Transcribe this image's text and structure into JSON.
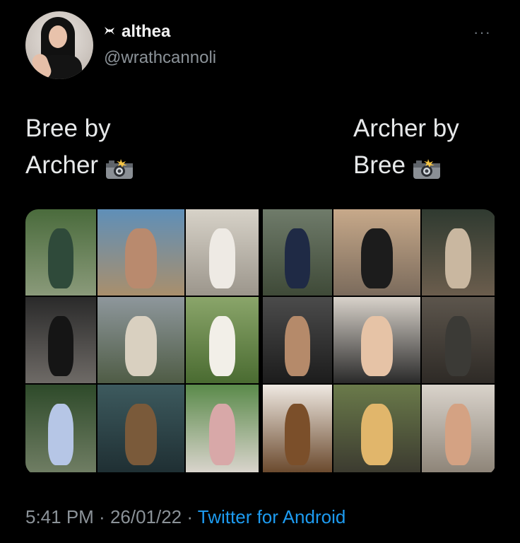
{
  "author": {
    "display_name": "althea",
    "handle": "@wrathcannoli",
    "name_icon": "bow-icon",
    "avatar_icon": "avatar-photo"
  },
  "more_label": "···",
  "tweet": {
    "left_lines": [
      "Bree by",
      "Archer"
    ],
    "right_lines": [
      "Archer by",
      "Bree"
    ],
    "emoji": "camera-with-flash-icon"
  },
  "media": {
    "left_photos": [
      {
        "name": "woman-bicycle-photo",
        "colors": [
          "#4a6b3c",
          "#8a9a7a"
        ],
        "fig": "#2f4a3a"
      },
      {
        "name": "woman-beach-crouch-photo",
        "colors": [
          "#5f8fb8",
          "#a98f6c"
        ],
        "fig": "#b98a6e"
      },
      {
        "name": "woman-kitchen-photo",
        "colors": [
          "#d7d2c8",
          "#9c968c"
        ],
        "fig": "#eeeae4"
      },
      {
        "name": "woman-mirror-photo",
        "colors": [
          "#2a2a2a",
          "#6e6a66"
        ],
        "fig": "#151515"
      },
      {
        "name": "woman-dog-hills-photo",
        "colors": [
          "#8e979c",
          "#4f5c45"
        ],
        "fig": "#d9d0c0"
      },
      {
        "name": "woman-white-dress-field-photo",
        "colors": [
          "#8aa56a",
          "#4a6b31"
        ],
        "fig": "#f2efe8"
      },
      {
        "name": "woman-garden-photo",
        "colors": [
          "#2e4a2a",
          "#6f7d63"
        ],
        "fig": "#b6c6e6"
      },
      {
        "name": "woman-pool-photo",
        "colors": [
          "#3d5a5e",
          "#1f2f33"
        ],
        "fig": "#7a5a3a"
      },
      {
        "name": "woman-pink-dress-pool-photo",
        "colors": [
          "#5a8a4a",
          "#d9d4cc"
        ],
        "fig": "#d8a8a8"
      }
    ],
    "right_photos": [
      {
        "name": "man-carrying-child-photo",
        "colors": [
          "#6f7b6a",
          "#3f4a38"
        ],
        "fig": "#1f2a45"
      },
      {
        "name": "man-beach-dog-photo",
        "colors": [
          "#c7a98a",
          "#7b6b5c"
        ],
        "fig": "#1c1c1c"
      },
      {
        "name": "man-chopping-wood-photo",
        "colors": [
          "#2f3a30",
          "#6b5d4d"
        ],
        "fig": "#c9b7a0"
      },
      {
        "name": "man-seated-portrait-photo",
        "colors": [
          "#4b4b4b",
          "#1c1c1c"
        ],
        "fig": "#b58a6a"
      },
      {
        "name": "man-holding-baby-photo",
        "colors": [
          "#d8d2ca",
          "#2a2a2a"
        ],
        "fig": "#e6c3a6"
      },
      {
        "name": "man-jacket-portrait-photo",
        "colors": [
          "#5c554c",
          "#2e2a26"
        ],
        "fig": "#3b3a36"
      },
      {
        "name": "man-brown-jacket-photo",
        "colors": [
          "#efe9e2",
          "#6b4a2e"
        ],
        "fig": "#7b4f2a"
      },
      {
        "name": "man-with-dogs-photo",
        "colors": [
          "#6a7a4a",
          "#3c3b30"
        ],
        "fig": "#e1b66b"
      },
      {
        "name": "man-kitchen-child-photo",
        "colors": [
          "#d9d3cb",
          "#8e8579"
        ],
        "fig": "#d4a283"
      }
    ]
  },
  "footer": {
    "time": "5:41 PM",
    "separator": " · ",
    "date": "26/01/22",
    "source": "Twitter for Android"
  }
}
